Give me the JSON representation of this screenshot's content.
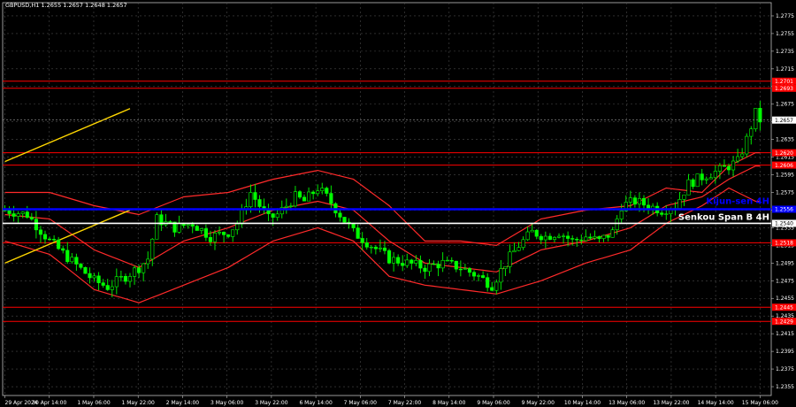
{
  "chart_data": {
    "type": "line",
    "title": "GBPUSD,H1  1.2655 1.2657 1.2648 1.2657",
    "current_price": "1.2657",
    "xlabel": "",
    "ylabel": "",
    "ylim": [
      1.2345,
      1.279
    ],
    "y_ticks": [
      "1.2775",
      "1.2755",
      "1.2735",
      "1.2715",
      "1.2695",
      "1.2675",
      "1.2655",
      "1.2635",
      "1.2615",
      "1.2595",
      "1.2575",
      "1.2555",
      "1.2535",
      "1.2515",
      "1.2495",
      "1.2475",
      "1.2455",
      "1.2435",
      "1.2415",
      "1.2395",
      "1.2375",
      "1.2355"
    ],
    "x_ticks": [
      "29 Apr 2024",
      "30 Apr 14:00",
      "1 May 06:00",
      "1 May 22:00",
      "2 May 14:00",
      "3 May 06:00",
      "3 May 22:00",
      "6 May 14:00",
      "7 May 06:00",
      "7 May 22:00",
      "8 May 14:00",
      "9 May 06:00",
      "9 May 22:00",
      "10 May 14:00",
      "13 May 06:00",
      "13 May 22:00",
      "14 May 14:00",
      "15 May 06:00"
    ],
    "grid": true,
    "levels": [
      {
        "value": 1.2701,
        "label": "1.2701",
        "color": "#ff0000"
      },
      {
        "value": 1.2693,
        "label": "1.2693",
        "color": "#ff0000"
      },
      {
        "value": 1.262,
        "label": "1.2620",
        "color": "#ff0000"
      },
      {
        "value": 1.2606,
        "label": "1.2606",
        "color": "#ff0000"
      },
      {
        "value": 1.2518,
        "label": "1.2518",
        "color": "#ff0000"
      },
      {
        "value": 1.2445,
        "label": "1.2445",
        "color": "#ff0000"
      },
      {
        "value": 1.2429,
        "label": "1.2429",
        "color": "#ff0000"
      }
    ],
    "ichimoku": {
      "kijun_value": 1.2556,
      "kijun_price_label": "1.2556",
      "kijun_text": "Kijun-sen 4H",
      "kijun_color": "#0000ff",
      "senkou_value": 1.254,
      "senkou_price_label": "1.2540",
      "senkou_text": "Senkou Span B 4H",
      "senkou_color": "#ffffff"
    },
    "trendlines": [
      {
        "from": [
          0,
          1.261
        ],
        "to": [
          28,
          1.267
        ],
        "color": "#ffd700"
      },
      {
        "from": [
          0,
          1.2495
        ],
        "to": [
          28,
          1.2555
        ],
        "color": "#ffd700"
      }
    ],
    "price_series": {
      "name": "GBPUSD H1",
      "color": "#00ff00",
      "count": 170,
      "anchors": [
        [
          0,
          1.2555
        ],
        [
          5,
          1.255
        ],
        [
          10,
          1.252
        ],
        [
          15,
          1.2497
        ],
        [
          20,
          1.2475
        ],
        [
          23,
          1.2468
        ],
        [
          27,
          1.248
        ],
        [
          30,
          1.249
        ],
        [
          32,
          1.25
        ],
        [
          34,
          1.2545
        ],
        [
          38,
          1.2535
        ],
        [
          42,
          1.254
        ],
        [
          46,
          1.2525
        ],
        [
          50,
          1.253
        ],
        [
          52,
          1.254
        ],
        [
          55,
          1.2575
        ],
        [
          57,
          1.256
        ],
        [
          59,
          1.2545
        ],
        [
          61,
          1.255
        ],
        [
          63,
          1.256
        ],
        [
          65,
          1.257
        ],
        [
          67,
          1.2565
        ],
        [
          70,
          1.258
        ],
        [
          72,
          1.257
        ],
        [
          75,
          1.255
        ],
        [
          78,
          1.253
        ],
        [
          82,
          1.2515
        ],
        [
          86,
          1.25
        ],
        [
          90,
          1.2495
        ],
        [
          94,
          1.249
        ],
        [
          98,
          1.2495
        ],
        [
          102,
          1.249
        ],
        [
          106,
          1.248
        ],
        [
          109,
          1.247
        ],
        [
          112,
          1.2495
        ],
        [
          115,
          1.2515
        ],
        [
          118,
          1.253
        ],
        [
          121,
          1.2525
        ],
        [
          124,
          1.253
        ],
        [
          127,
          1.252
        ],
        [
          130,
          1.2525
        ],
        [
          133,
          1.252
        ],
        [
          136,
          1.253
        ],
        [
          138,
          1.256
        ],
        [
          141,
          1.2565
        ],
        [
          144,
          1.256
        ],
        [
          147,
          1.2555
        ],
        [
          150,
          1.256
        ],
        [
          153,
          1.2585
        ],
        [
          157,
          1.2595
        ],
        [
          160,
          1.26
        ],
        [
          164,
          1.261
        ],
        [
          166,
          1.2635
        ],
        [
          168,
          1.2665
        ],
        [
          169,
          1.2657
        ]
      ]
    },
    "bollinger": {
      "color": "#ff2a2a",
      "upper": [
        [
          0,
          1.2575
        ],
        [
          10,
          1.2575
        ],
        [
          20,
          1.256
        ],
        [
          30,
          1.255
        ],
        [
          40,
          1.257
        ],
        [
          50,
          1.2575
        ],
        [
          60,
          1.259
        ],
        [
          70,
          1.26
        ],
        [
          78,
          1.259
        ],
        [
          86,
          1.256
        ],
        [
          94,
          1.252
        ],
        [
          102,
          1.252
        ],
        [
          110,
          1.2515
        ],
        [
          120,
          1.2545
        ],
        [
          130,
          1.2555
        ],
        [
          140,
          1.256
        ],
        [
          148,
          1.258
        ],
        [
          156,
          1.2575
        ],
        [
          162,
          1.2605
        ],
        [
          168,
          1.262
        ]
      ],
      "middle": [
        [
          0,
          1.255
        ],
        [
          10,
          1.2545
        ],
        [
          20,
          1.251
        ],
        [
          30,
          1.249
        ],
        [
          40,
          1.252
        ],
        [
          50,
          1.2535
        ],
        [
          60,
          1.2555
        ],
        [
          70,
          1.2565
        ],
        [
          78,
          1.2555
        ],
        [
          86,
          1.252
        ],
        [
          94,
          1.2495
        ],
        [
          102,
          1.249
        ],
        [
          110,
          1.2485
        ],
        [
          120,
          1.251
        ],
        [
          130,
          1.252
        ],
        [
          140,
          1.2535
        ],
        [
          148,
          1.256
        ],
        [
          156,
          1.257
        ],
        [
          162,
          1.259
        ],
        [
          168,
          1.2605
        ]
      ],
      "lower": [
        [
          0,
          1.252
        ],
        [
          10,
          1.2505
        ],
        [
          20,
          1.2465
        ],
        [
          30,
          1.245
        ],
        [
          40,
          1.247
        ],
        [
          50,
          1.249
        ],
        [
          60,
          1.252
        ],
        [
          70,
          1.2535
        ],
        [
          78,
          1.252
        ],
        [
          86,
          1.248
        ],
        [
          94,
          1.247
        ],
        [
          102,
          1.2465
        ],
        [
          110,
          1.246
        ],
        [
          120,
          1.2475
        ],
        [
          130,
          1.2495
        ],
        [
          140,
          1.251
        ],
        [
          148,
          1.254
        ],
        [
          156,
          1.256
        ],
        [
          162,
          1.258
        ],
        [
          168,
          1.2565
        ]
      ]
    }
  }
}
